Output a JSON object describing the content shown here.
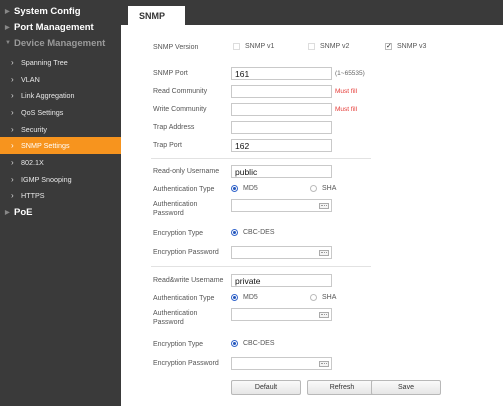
{
  "sidebar": {
    "top_items": [
      {
        "label": "System Config"
      },
      {
        "label": "Port Management"
      },
      {
        "label": "Device Management"
      }
    ],
    "sub_items": [
      {
        "label": "Spanning Tree"
      },
      {
        "label": "VLAN"
      },
      {
        "label": "Link Aggregation"
      },
      {
        "label": "QoS Settings"
      },
      {
        "label": "Security"
      },
      {
        "label": "SNMP Settings"
      },
      {
        "label": "802.1X"
      },
      {
        "label": "IGMP Snooping"
      },
      {
        "label": "HTTPS"
      }
    ],
    "bottom_item": {
      "label": "PoE"
    },
    "active_color": "#f7941e"
  },
  "tab": {
    "label": "SNMP"
  },
  "snmp": {
    "version_label": "SNMP Version",
    "v1": "SNMP v1",
    "v2": "SNMP v2",
    "v3": "SNMP v3",
    "port_label": "SNMP Port",
    "port_value": "161",
    "port_range": "(1~65535)",
    "read_community_label": "Read Community",
    "write_community_label": "Write Community",
    "must_fill": "Must fill",
    "trap_address_label": "Trap Address",
    "trap_port_label": "Trap Port",
    "trap_port_value": "162"
  },
  "readonly": {
    "username_label": "Read-only Username",
    "username_value": "public",
    "auth_type_label": "Authentication Type",
    "md5": "MD5",
    "sha": "SHA",
    "auth_pw_label": "Authentication Password",
    "enc_type_label": "Encryption Type",
    "cbc": "CBC-DES",
    "enc_pw_label": "Encryption Password"
  },
  "readwrite": {
    "username_label": "Read&write Username",
    "username_value": "private",
    "auth_type_label": "Authentication Type",
    "md5": "MD5",
    "sha": "SHA",
    "auth_pw_label": "Authentication Password",
    "enc_type_label": "Encryption Type",
    "cbc": "CBC-DES",
    "enc_pw_label": "Encryption Password"
  },
  "buttons": {
    "default": "Default",
    "refresh": "Refresh",
    "save": "Save"
  }
}
